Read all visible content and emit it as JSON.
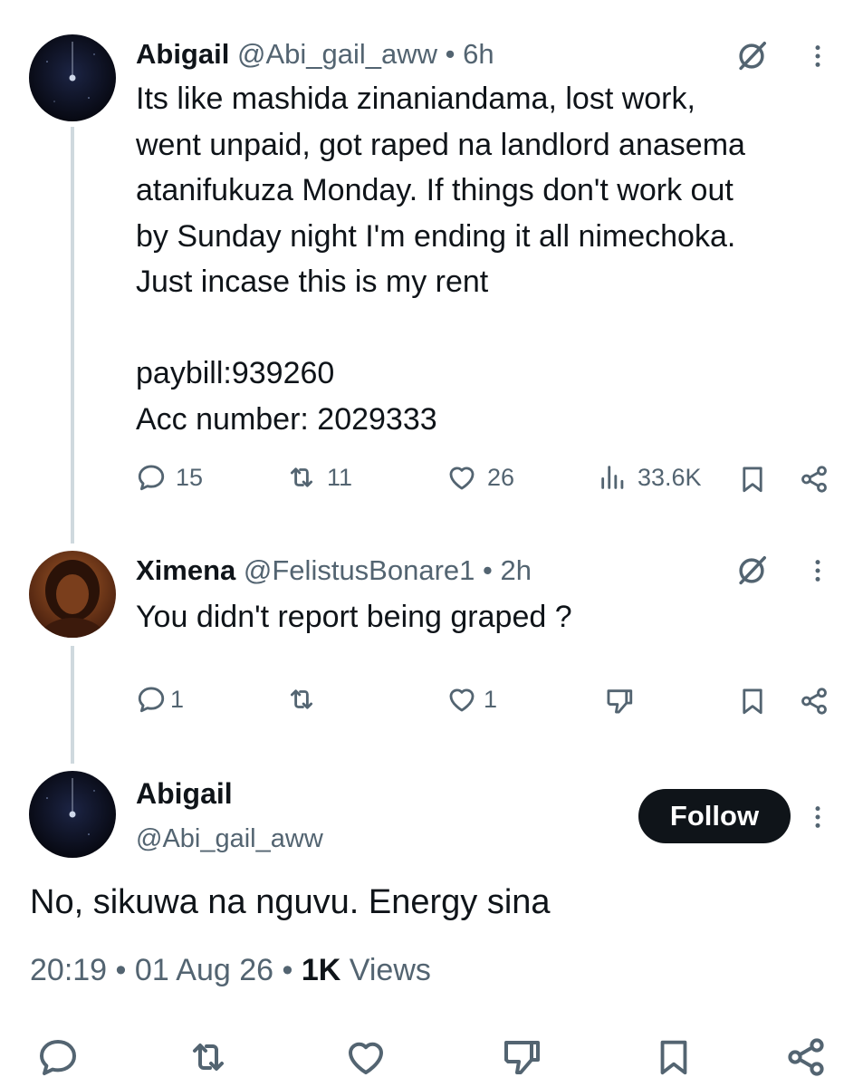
{
  "reply_thread": [
    {
      "display_name": "Abigail",
      "handle": "@Abi_gail_aww",
      "time": "6h",
      "text": "Its like mashida zinaniandama, lost work,\nwent unpaid, got raped na landlord anasema\natanifukuza Monday. If things don't work out\nby Sunday night I'm ending it all nimechoka.\nJust incase this is my rent\n\npaybill:939260\nAcc number: 2029333",
      "replies": "15",
      "reposts": "11",
      "likes": "26",
      "views": "33.6K"
    },
    {
      "display_name": "Ximena",
      "handle": "@FelistusBonare1",
      "time": "2h",
      "text": "You didn't report being graped ?",
      "replies": "1",
      "reposts": "",
      "likes": "1"
    }
  ],
  "main_tweet": {
    "display_name": "Abigail",
    "handle": "@Abi_gail_aww",
    "follow_label": "Follow",
    "text": "No, sikuwa na nguvu. Energy sina",
    "time": "20:19",
    "date": "01 Aug 26",
    "views_count": "1K",
    "views_label": "Views"
  },
  "separator": "•",
  "icons": [
    "reply-icon",
    "repost-icon",
    "like-icon",
    "views-icon",
    "bookmark-icon",
    "share-icon",
    "grok-icon",
    "more-icon",
    "downvote-icon"
  ]
}
